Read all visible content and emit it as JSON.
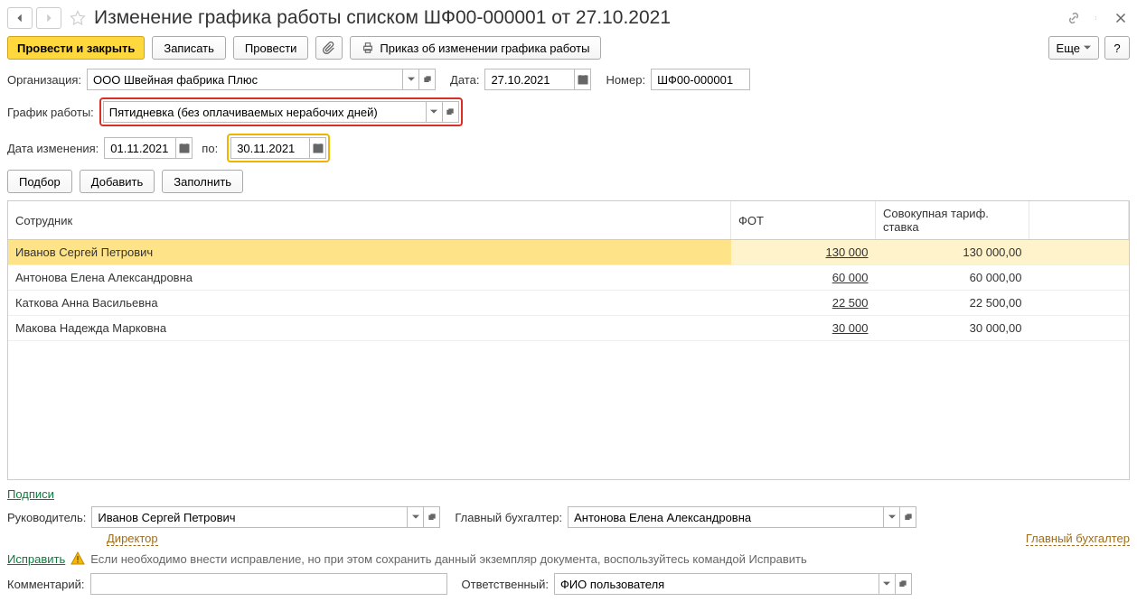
{
  "header": {
    "title": "Изменение графика работы списком ШФ00-000001 от 27.10.2021"
  },
  "toolbar": {
    "post_close": "Провести и закрыть",
    "save": "Записать",
    "post": "Провести",
    "print_order": "Приказ об изменении графика работы",
    "more": "Еще",
    "help": "?"
  },
  "fields": {
    "org_label": "Организация:",
    "org_value": "ООО Швейная фабрика Плюс",
    "date_label": "Дата:",
    "date_value": "27.10.2021",
    "number_label": "Номер:",
    "number_value": "ШФ00-000001",
    "schedule_label": "График работы:",
    "schedule_value": "Пятидневка (без оплачиваемых нерабочих дней)",
    "change_date_label": "Дата изменения:",
    "change_date_value": "01.11.2021",
    "to_label": "по:",
    "to_value": "30.11.2021"
  },
  "table_toolbar": {
    "pick": "Подбор",
    "add": "Добавить",
    "fill": "Заполнить"
  },
  "table": {
    "cols": {
      "employee": "Сотрудник",
      "fot": "ФОТ",
      "rate": "Совокупная тариф. ставка"
    },
    "rows": [
      {
        "name": "Иванов Сергей Петрович",
        "fot": "130 000",
        "rate": "130 000,00"
      },
      {
        "name": "Антонова Елена Александровна",
        "fot": "60 000",
        "rate": "60 000,00"
      },
      {
        "name": "Каткова Анна Васильевна",
        "fot": "22 500",
        "rate": "22 500,00"
      },
      {
        "name": "Макова Надежда Марковна",
        "fot": "30 000",
        "rate": "30 000,00"
      }
    ]
  },
  "signatures": {
    "title": "Подписи",
    "head_label": "Руководитель:",
    "head_value": "Иванов Сергей Петрович",
    "head_pos": "Директор",
    "acc_label": "Главный бухгалтер:",
    "acc_value": "Антонова Елена Александровна",
    "acc_pos": "Главный бухгалтер"
  },
  "correction": {
    "link": "Исправить",
    "text": "Если необходимо внести исправление, но при этом сохранить данный экземпляр документа, воспользуйтесь командой Исправить"
  },
  "footer": {
    "comment_label": "Комментарий:",
    "comment_value": "",
    "resp_label": "Ответственный:",
    "resp_value": "ФИО пользователя"
  }
}
